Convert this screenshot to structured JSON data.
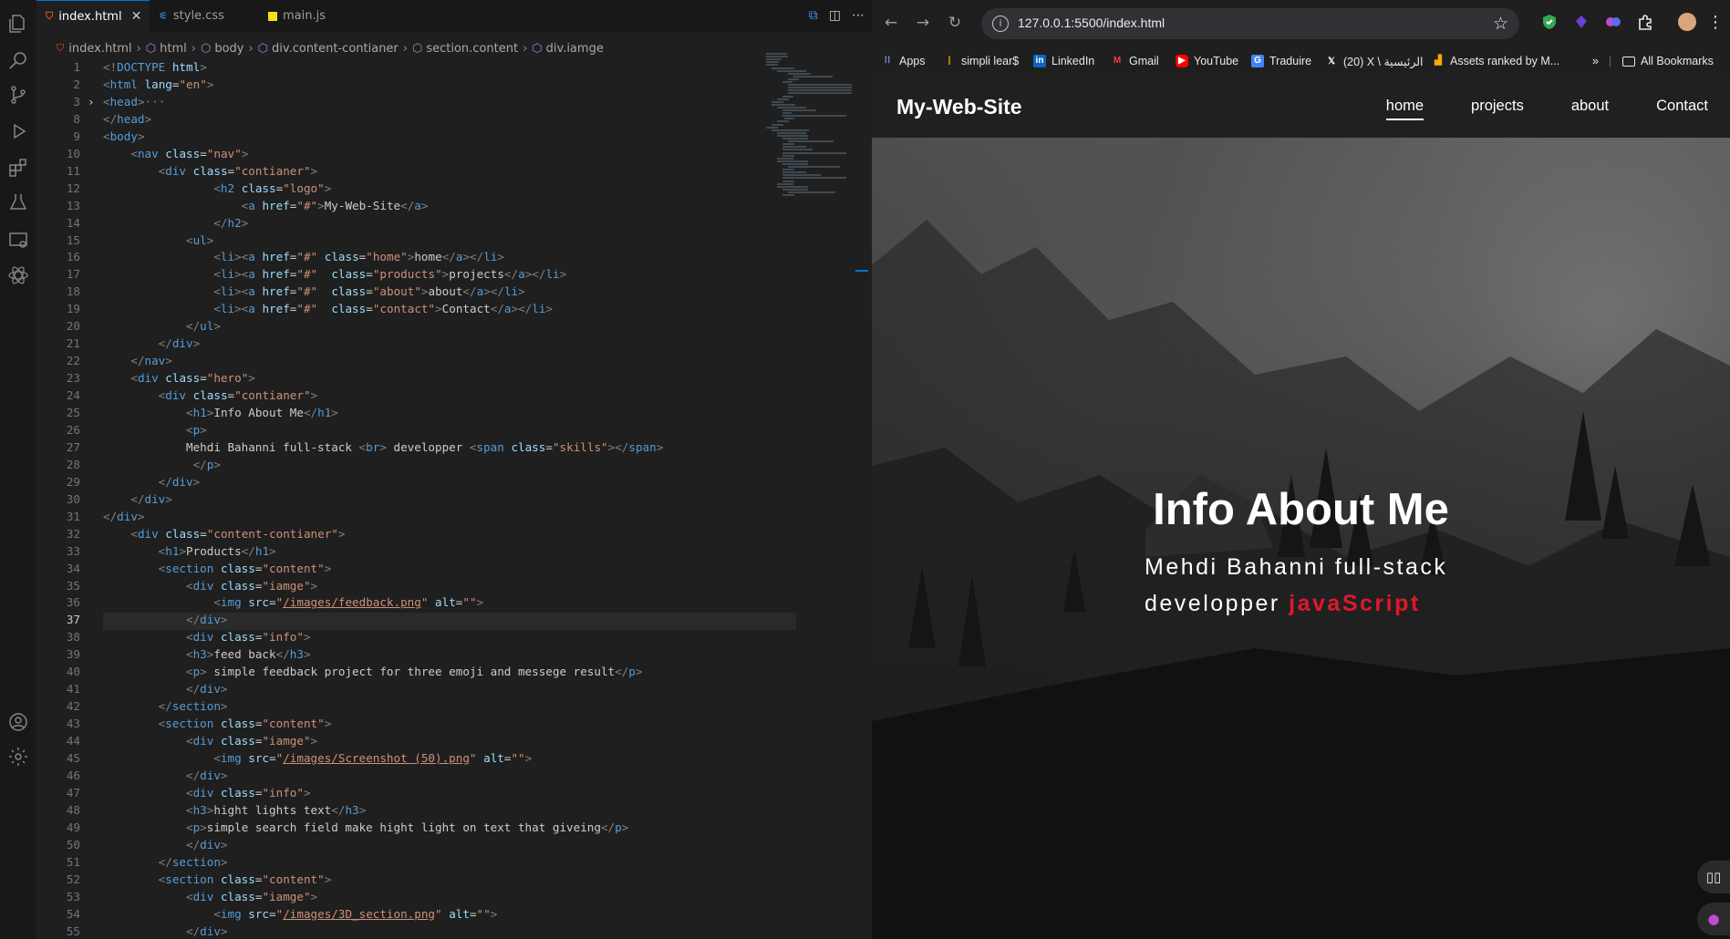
{
  "vscode": {
    "tabs": [
      {
        "label": "index.html",
        "icon": "html5-icon",
        "active": true
      },
      {
        "label": "style.css",
        "icon": "css-icon",
        "active": false
      },
      {
        "label": "main.js",
        "icon": "js-icon",
        "active": false
      }
    ],
    "breadcrumb": [
      "index.html",
      "html",
      "body",
      "div.content-contianer",
      "section.content",
      "div.iamge"
    ],
    "current_line": 37,
    "lines": [
      {
        "n": 1,
        "html": "<span class='pu'>&lt;!</span><span class='tg'>DOCTYPE</span> <span class='at'>html</span><span class='pu'>&gt;</span>"
      },
      {
        "n": 2,
        "html": "<span class='pu'>&lt;</span><span class='tg'>html</span> <span class='at'>lang</span>=<span class='st'>\"en\"</span><span class='pu'>&gt;</span>"
      },
      {
        "n": 3,
        "html": "<span class='pu'>&lt;</span><span class='tg'>head</span><span class='pu'>&gt;</span><span class='cm'>···</span>"
      },
      {
        "n": 8,
        "html": "<span class='pu'>&lt;/</span><span class='tg'>head</span><span class='pu'>&gt;</span>"
      },
      {
        "n": 9,
        "html": "<span class='pu'>&lt;</span><span class='tg'>body</span><span class='pu'>&gt;</span>"
      },
      {
        "n": 10,
        "html": "    <span class='pu'>&lt;</span><span class='tg'>nav</span> <span class='at'>class</span>=<span class='st'>\"nav\"</span><span class='pu'>&gt;</span>"
      },
      {
        "n": 11,
        "html": "        <span class='pu'>&lt;</span><span class='tg'>div</span> <span class='at'>class</span>=<span class='st'>\"contianer\"</span><span class='pu'>&gt;</span>"
      },
      {
        "n": 12,
        "html": "                <span class='pu'>&lt;</span><span class='tg'>h2</span> <span class='at'>class</span>=<span class='st'>\"logo\"</span><span class='pu'>&gt;</span>"
      },
      {
        "n": 13,
        "html": "                    <span class='pu'>&lt;</span><span class='tg'>a</span> <span class='at'>href</span>=<span class='st'>\"#\"</span><span class='pu'>&gt;</span>My-Web-Site<span class='pu'>&lt;/</span><span class='tg'>a</span><span class='pu'>&gt;</span>"
      },
      {
        "n": 14,
        "html": "                <span class='pu'>&lt;/</span><span class='tg'>h2</span><span class='pu'>&gt;</span>"
      },
      {
        "n": 15,
        "html": "            <span class='pu'>&lt;</span><span class='tg'>ul</span><span class='pu'>&gt;</span>"
      },
      {
        "n": 16,
        "html": "                <span class='pu'>&lt;</span><span class='tg'>li</span><span class='pu'>&gt;&lt;</span><span class='tg'>a</span> <span class='at'>href</span>=<span class='st'>\"#\"</span> <span class='at'>class</span>=<span class='st'>\"home\"</span><span class='pu'>&gt;</span>home<span class='pu'>&lt;/</span><span class='tg'>a</span><span class='pu'>&gt;&lt;/</span><span class='tg'>li</span><span class='pu'>&gt;</span>"
      },
      {
        "n": 17,
        "html": "                <span class='pu'>&lt;</span><span class='tg'>li</span><span class='pu'>&gt;&lt;</span><span class='tg'>a</span> <span class='at'>href</span>=<span class='st'>\"#\"</span>  <span class='at'>class</span>=<span class='st'>\"products\"</span><span class='pu'>&gt;</span>projects<span class='pu'>&lt;/</span><span class='tg'>a</span><span class='pu'>&gt;&lt;/</span><span class='tg'>li</span><span class='pu'>&gt;</span>"
      },
      {
        "n": 18,
        "html": "                <span class='pu'>&lt;</span><span class='tg'>li</span><span class='pu'>&gt;&lt;</span><span class='tg'>a</span> <span class='at'>href</span>=<span class='st'>\"#\"</span>  <span class='at'>class</span>=<span class='st'>\"about\"</span><span class='pu'>&gt;</span>about<span class='pu'>&lt;/</span><span class='tg'>a</span><span class='pu'>&gt;&lt;/</span><span class='tg'>li</span><span class='pu'>&gt;</span>"
      },
      {
        "n": 19,
        "html": "                <span class='pu'>&lt;</span><span class='tg'>li</span><span class='pu'>&gt;&lt;</span><span class='tg'>a</span> <span class='at'>href</span>=<span class='st'>\"#\"</span>  <span class='at'>class</span>=<span class='st'>\"contact\"</span><span class='pu'>&gt;</span>Contact<span class='pu'>&lt;/</span><span class='tg'>a</span><span class='pu'>&gt;&lt;/</span><span class='tg'>li</span><span class='pu'>&gt;</span>"
      },
      {
        "n": 20,
        "html": "            <span class='pu'>&lt;/</span><span class='tg'>ul</span><span class='pu'>&gt;</span>"
      },
      {
        "n": 21,
        "html": "        <span class='pu'>&lt;/</span><span class='tg'>div</span><span class='pu'>&gt;</span>"
      },
      {
        "n": 22,
        "html": "    <span class='pu'>&lt;/</span><span class='tg'>nav</span><span class='pu'>&gt;</span>"
      },
      {
        "n": 23,
        "html": "    <span class='pu'>&lt;</span><span class='tg'>div</span> <span class='at'>class</span>=<span class='st'>\"hero\"</span><span class='pu'>&gt;</span>"
      },
      {
        "n": 24,
        "html": "        <span class='pu'>&lt;</span><span class='tg'>div</span> <span class='at'>class</span>=<span class='st'>\"contianer\"</span><span class='pu'>&gt;</span>"
      },
      {
        "n": 25,
        "html": "            <span class='pu'>&lt;</span><span class='tg'>h1</span><span class='pu'>&gt;</span>Info About Me<span class='pu'>&lt;/</span><span class='tg'>h1</span><span class='pu'>&gt;</span>"
      },
      {
        "n": 26,
        "html": "            <span class='pu'>&lt;</span><span class='tg'>p</span><span class='pu'>&gt;</span>"
      },
      {
        "n": 27,
        "html": "            Mehdi Bahanni full-stack <span class='pu'>&lt;</span><span class='tg'>br</span><span class='pu'>&gt;</span> developper <span class='pu'>&lt;</span><span class='tg'>span</span> <span class='at'>class</span>=<span class='st'>\"skills\"</span><span class='pu'>&gt;&lt;/</span><span class='tg'>span</span><span class='pu'>&gt;</span>"
      },
      {
        "n": 28,
        "html": "             <span class='pu'>&lt;/</span><span class='tg'>p</span><span class='pu'>&gt;</span>"
      },
      {
        "n": 29,
        "html": "        <span class='pu'>&lt;/</span><span class='tg'>div</span><span class='pu'>&gt;</span>"
      },
      {
        "n": 30,
        "html": "    <span class='pu'>&lt;/</span><span class='tg'>div</span><span class='pu'>&gt;</span>"
      },
      {
        "n": 31,
        "html": "<span class='pu'>&lt;/</span><span class='tg'>div</span><span class='pu'>&gt;</span>"
      },
      {
        "n": 32,
        "html": "    <span class='pu'>&lt;</span><span class='tg'>div</span> <span class='at'>class</span>=<span class='st'>\"content-contianer\"</span><span class='pu'>&gt;</span>"
      },
      {
        "n": 33,
        "html": "        <span class='pu'>&lt;</span><span class='tg'>h1</span><span class='pu'>&gt;</span>Products<span class='pu'>&lt;/</span><span class='tg'>h1</span><span class='pu'>&gt;</span>"
      },
      {
        "n": 34,
        "html": "        <span class='pu'>&lt;</span><span class='tg'>section</span> <span class='at'>class</span>=<span class='st'>\"content\"</span><span class='pu'>&gt;</span>"
      },
      {
        "n": 35,
        "html": "            <span class='pu'>&lt;</span><span class='tg'>div</span> <span class='at'>class</span>=<span class='st'>\"iamge\"</span><span class='pu'>&gt;</span>"
      },
      {
        "n": 36,
        "html": "                <span class='pu'>&lt;</span><span class='tg'>img</span> <span class='at'>src</span>=<span class='st'>\"<u>/images/feedback.png</u>\"</span> <span class='at'>alt</span>=<span class='st'>\"\"</span><span class='pu'>&gt;</span>"
      },
      {
        "n": 37,
        "html": "            <span class='pu'>&lt;/</span><span class='tg'>div</span><span class='pu'>&gt;</span>"
      },
      {
        "n": 38,
        "html": "            <span class='pu'>&lt;</span><span class='tg'>div</span> <span class='at'>class</span>=<span class='st'>\"info\"</span><span class='pu'>&gt;</span>"
      },
      {
        "n": 39,
        "html": "            <span class='pu'>&lt;</span><span class='tg'>h3</span><span class='pu'>&gt;</span>feed back<span class='pu'>&lt;/</span><span class='tg'>h3</span><span class='pu'>&gt;</span>"
      },
      {
        "n": 40,
        "html": "            <span class='pu'>&lt;</span><span class='tg'>p</span><span class='pu'>&gt;</span> simple feedback project for three emoji and messege result<span class='pu'>&lt;/</span><span class='tg'>p</span><span class='pu'>&gt;</span>"
      },
      {
        "n": 41,
        "html": "            <span class='pu'>&lt;/</span><span class='tg'>div</span><span class='pu'>&gt;</span>"
      },
      {
        "n": 42,
        "html": "        <span class='pu'>&lt;/</span><span class='tg'>section</span><span class='pu'>&gt;</span>"
      },
      {
        "n": 43,
        "html": "        <span class='pu'>&lt;</span><span class='tg'>section</span> <span class='at'>class</span>=<span class='st'>\"content\"</span><span class='pu'>&gt;</span>"
      },
      {
        "n": 44,
        "html": "            <span class='pu'>&lt;</span><span class='tg'>div</span> <span class='at'>class</span>=<span class='st'>\"iamge\"</span><span class='pu'>&gt;</span>"
      },
      {
        "n": 45,
        "html": "                <span class='pu'>&lt;</span><span class='tg'>img</span> <span class='at'>src</span>=<span class='st'>\"<u>/images/Screenshot (50).png</u>\"</span> <span class='at'>alt</span>=<span class='st'>\"\"</span><span class='pu'>&gt;</span>"
      },
      {
        "n": 46,
        "html": "            <span class='pu'>&lt;/</span><span class='tg'>div</span><span class='pu'>&gt;</span>"
      },
      {
        "n": 47,
        "html": "            <span class='pu'>&lt;</span><span class='tg'>div</span> <span class='at'>class</span>=<span class='st'>\"info\"</span><span class='pu'>&gt;</span>"
      },
      {
        "n": 48,
        "html": "            <span class='pu'>&lt;</span><span class='tg'>h3</span><span class='pu'>&gt;</span>hight lights text<span class='pu'>&lt;/</span><span class='tg'>h3</span><span class='pu'>&gt;</span>"
      },
      {
        "n": 49,
        "html": "            <span class='pu'>&lt;</span><span class='tg'>p</span><span class='pu'>&gt;</span>simple search field make hight light on text that giveing<span class='pu'>&lt;/</span><span class='tg'>p</span><span class='pu'>&gt;</span>"
      },
      {
        "n": 50,
        "html": "            <span class='pu'>&lt;/</span><span class='tg'>div</span><span class='pu'>&gt;</span>"
      },
      {
        "n": 51,
        "html": "        <span class='pu'>&lt;/</span><span class='tg'>section</span><span class='pu'>&gt;</span>"
      },
      {
        "n": 52,
        "html": "        <span class='pu'>&lt;</span><span class='tg'>section</span> <span class='at'>class</span>=<span class='st'>\"content\"</span><span class='pu'>&gt;</span>"
      },
      {
        "n": 53,
        "html": "            <span class='pu'>&lt;</span><span class='tg'>div</span> <span class='at'>class</span>=<span class='st'>\"iamge\"</span><span class='pu'>&gt;</span>"
      },
      {
        "n": 54,
        "html": "                <span class='pu'>&lt;</span><span class='tg'>img</span> <span class='at'>src</span>=<span class='st'>\"<u>/images/3D_section.png</u>\"</span> <span class='at'>alt</span>=<span class='st'>\"\"</span><span class='pu'>&gt;</span>"
      },
      {
        "n": 55,
        "html": "            <span class='pu'>&lt;/</span><span class='tg'>div</span><span class='pu'>&gt;</span>"
      }
    ]
  },
  "browser": {
    "url": "127.0.0.1:5500/index.html",
    "bookmarks": [
      {
        "label": "Apps",
        "icon": "apps-grid-icon"
      },
      {
        "label": "simpli lear$",
        "icon": "simplilearn-icon"
      },
      {
        "label": "LinkedIn",
        "icon": "linkedin-icon"
      },
      {
        "label": "Gmail",
        "icon": "gmail-icon"
      },
      {
        "label": "YouTube",
        "icon": "youtube-icon"
      },
      {
        "label": "Traduire",
        "icon": "translate-icon"
      },
      {
        "label": "(20) X \\ الرئيسية",
        "icon": "x-icon"
      },
      {
        "label": "Assets ranked by M...",
        "icon": "bar-chart-icon"
      }
    ],
    "all_bookmarks_label": "All Bookmarks",
    "site": {
      "logo": "My-Web-Site",
      "nav": [
        "home",
        "projects",
        "about",
        "Contact"
      ],
      "hero_title": "Info About Me",
      "hero_line1": "Mehdi Bahanni full-stack",
      "hero_line2": "developper",
      "skills": "javaScript"
    }
  },
  "colors": {
    "accent": "#0078d4",
    "skills": "#e0182d",
    "editor_bg": "#1f1f1f",
    "tag": "#569cd6",
    "attr": "#9cdcfe",
    "string": "#ce9178"
  }
}
